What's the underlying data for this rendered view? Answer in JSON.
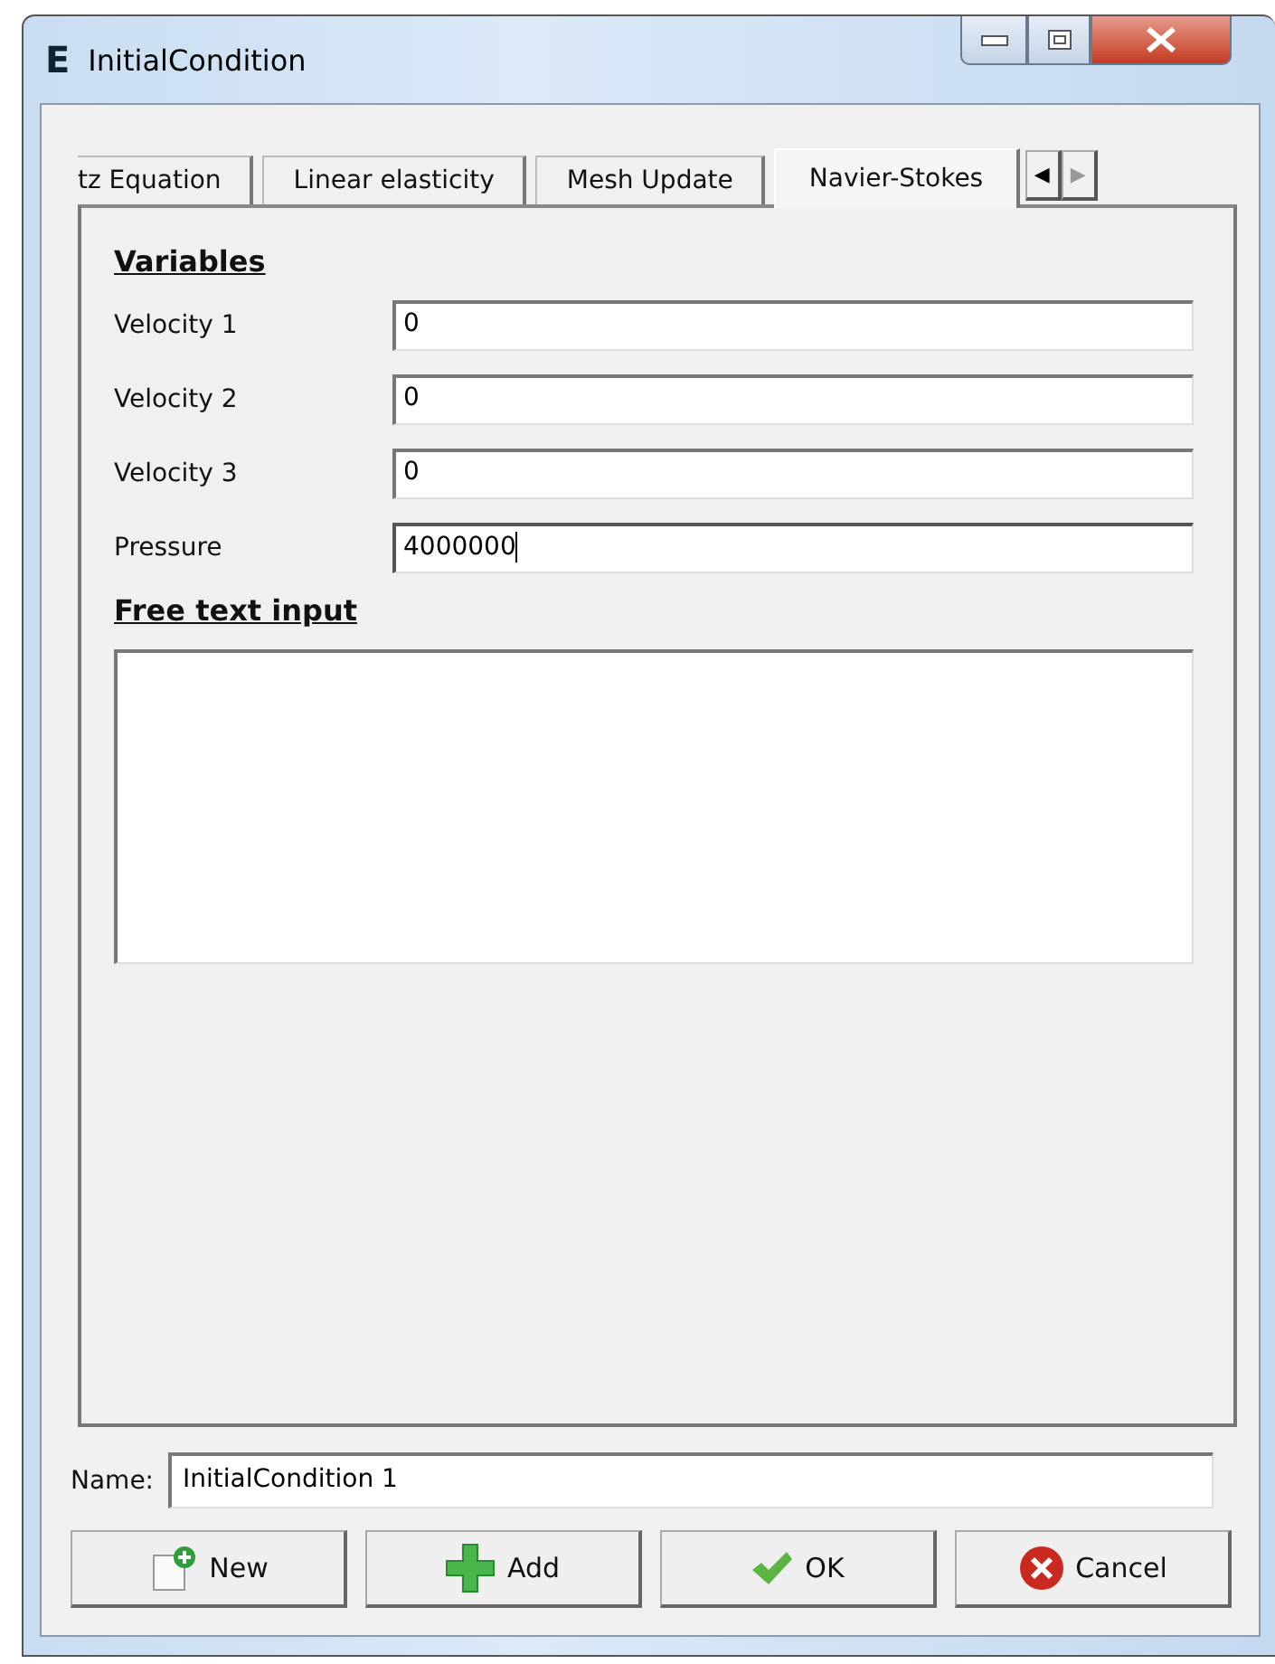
{
  "window": {
    "title": "InitialCondition",
    "app_letter": "E"
  },
  "tabs": [
    {
      "label": "tz Equation",
      "selected": false
    },
    {
      "label": "Linear elasticity",
      "selected": false
    },
    {
      "label": "Mesh Update",
      "selected": false
    },
    {
      "label": "Navier-Stokes",
      "selected": true
    }
  ],
  "tab_scroll": {
    "left": "◀",
    "right": "▶"
  },
  "variables": {
    "heading": "Variables",
    "fields": [
      {
        "label": "Velocity 1",
        "value": "0",
        "focused": false
      },
      {
        "label": "Velocity 2",
        "value": "0",
        "focused": false
      },
      {
        "label": "Velocity 3",
        "value": "0",
        "focused": false
      },
      {
        "label": "Pressure",
        "value": "4000000",
        "focused": true
      }
    ]
  },
  "free_text": {
    "heading": "Free text input"
  },
  "name_field": {
    "label": "Name:",
    "value": "InitialCondition 1"
  },
  "buttons": [
    {
      "label": "New",
      "kind": "new"
    },
    {
      "label": "Add",
      "kind": "add"
    },
    {
      "label": "OK",
      "kind": "ok"
    },
    {
      "label": "Cancel",
      "kind": "cancel"
    }
  ]
}
